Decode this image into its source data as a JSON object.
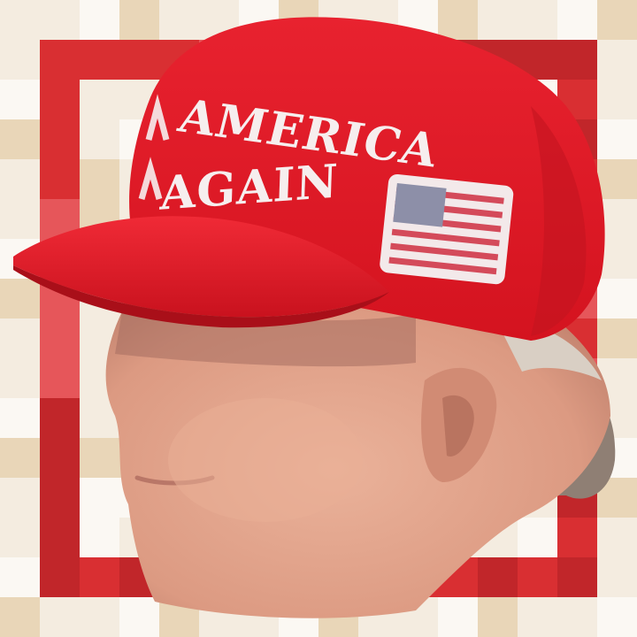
{
  "image": {
    "subject": "head-cutout-with-red-cap",
    "colors": {
      "bg_tile_light": "#f4ece0",
      "bg_tile_tan": "#e9d6b8",
      "bg_tile_white": "#fbf8f3",
      "frame_red": "#d92f32",
      "frame_red_dark": "#c1262a",
      "frame_red_light": "#e6565a",
      "cap_red": "#e51c2a",
      "cap_red_shadow": "#b8141f",
      "cap_text": "#f6eeee",
      "skin": "#e3a48c",
      "skin_shadow": "#b97b68",
      "hair": "#d9cfc4",
      "patch_white": "#f3e9ea",
      "patch_red": "#d44a5a",
      "patch_blue": "#8d8fa8"
    }
  },
  "cap": {
    "text_line_1": "AMERICA",
    "text_line_2": "AGAIN"
  }
}
